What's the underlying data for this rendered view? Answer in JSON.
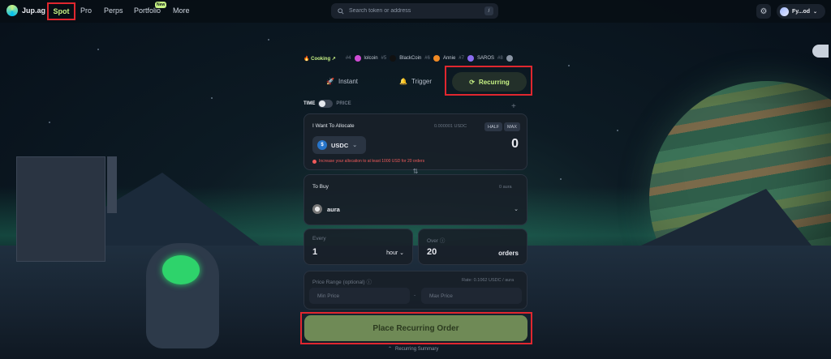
{
  "nav": {
    "logo_text": "Jup.ag",
    "items": [
      "Spot",
      "Pro",
      "Perps",
      "Portfolio",
      "More"
    ],
    "new_badge": "New",
    "search_placeholder": "Search token or address",
    "search_shortcut": "/",
    "wallet_label": "Fy...od"
  },
  "trending": {
    "cooking_label": "Cooking",
    "tokens": [
      {
        "rank": "#4",
        "name": "lolcoin"
      },
      {
        "rank": "#5",
        "name": "BlackCoin"
      },
      {
        "rank": "#6",
        "name": "Annie"
      },
      {
        "rank": "#7",
        "name": "SAROS"
      },
      {
        "rank": "#8",
        "name": ""
      }
    ]
  },
  "tabs": {
    "instant": "Instant",
    "trigger": "Trigger",
    "recurring": "Recurring"
  },
  "mode_toggle": {
    "left": "TIME",
    "right": "PRICE"
  },
  "allocate": {
    "label": "I Want To Allocate",
    "balance": "0.000001 USDC",
    "half": "HALF",
    "max": "MAX",
    "token": "USDC",
    "amount": "0",
    "warning": "Increase your allocation to at least 1000 USD for 20 orders"
  },
  "buy": {
    "label": "To Buy",
    "balance": "0 aura",
    "token": "aura"
  },
  "every": {
    "label": "Every",
    "value": "1",
    "unit": "hour"
  },
  "over": {
    "label": "Over",
    "value": "20",
    "unit": "orders"
  },
  "price_range": {
    "label": "Price Range (optional)",
    "rate": "Rate: 0.1062 USDC / aura",
    "min_placeholder": "Min Price",
    "max_placeholder": "Max Price",
    "separator": "-"
  },
  "place_button": "Place Recurring Order",
  "summary": "Recurring Summary",
  "colors": {
    "accent": "#c7f284",
    "highlight_red": "#e0272f",
    "warning": "#f05a5a",
    "button": "#6f8a56"
  }
}
